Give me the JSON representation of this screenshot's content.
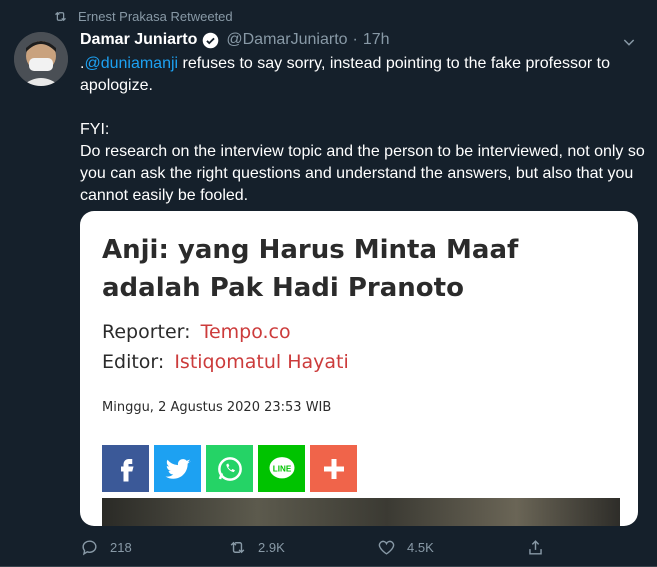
{
  "retweet": {
    "text": "Ernest Prakasa Retweeted",
    "icon": "retweet-icon"
  },
  "author": {
    "name": "Damar Juniarto",
    "handle": "@DamarJuniarto",
    "separator": "·",
    "time": "17h"
  },
  "tweet": {
    "prefix": ".",
    "mention": "@duniamanji",
    "line1_rest": " refuses to say sorry, instead pointing to the fake professor to apologize.",
    "fyi": "FYI:",
    "body": "Do research on the interview topic and the person to be interviewed, not only so you can ask the right questions and understand the answers, but also that you cannot easily be fooled."
  },
  "card": {
    "title": "Anji: yang Harus Minta Maaf adalah Pak Hadi Pranoto",
    "reporter_label": "Reporter:",
    "reporter_value": "Tempo.co",
    "editor_label": "Editor:",
    "editor_value": "Istiqomatul Hayati",
    "date": "Minggu, 2 Agustus 2020 23:53 WIB",
    "line_label": "LINE"
  },
  "actions": {
    "replies": "218",
    "retweets": "2.9K",
    "likes": "4.5K"
  },
  "colors": {
    "background": "#15202b",
    "accent": "#1da1f2",
    "muted": "#8899a6",
    "article_red": "#cc3b3b"
  }
}
